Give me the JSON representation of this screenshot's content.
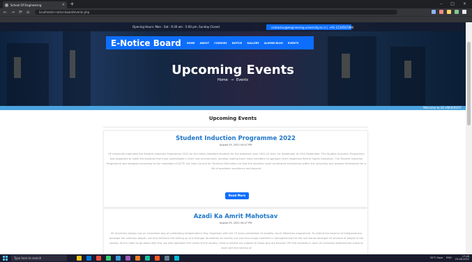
{
  "browser": {
    "tab_title": "School Of Engineering",
    "tab_close": "×",
    "new_tab": "+",
    "url": "localhost/e-notice-board/events.php",
    "bookmark": "M.Sc B.Tech",
    "window_controls": [
      "–",
      "□",
      "×"
    ],
    "nav_icons": [
      "←",
      "→",
      "⟳",
      "⌂"
    ],
    "ext_colors": [
      "#8ab4f8",
      "#f28b82",
      "#fdd663",
      "#81c995",
      "#e8eaed"
    ]
  },
  "topbar": {
    "hours": "Opening Hours: Mon - Sat : 9:30 am - 5:00 pm, Sunday Closed",
    "contact": "contactus@engineering.university.ac.in | +91-1234567890"
  },
  "navbar": {
    "brand": "E-Notice Board",
    "menu": [
      "HOME",
      "ABOUT",
      "COURSES",
      "NOTICE",
      "GALLERY",
      "ALUMNI BLOG",
      "EVENTS"
    ]
  },
  "hero": {
    "title": "Upcoming Events",
    "crumb_home": "Home",
    "crumb_arrow": "→",
    "crumb_current": "Events"
  },
  "welcome": "Welcome to SE UNIVERSITY",
  "section_heading": "Upcoming Events",
  "events": [
    {
      "title": "Student Induction Programme 2022",
      "date": "August 29, 2022 04:47 PM",
      "body": "SE University organised the Student Induction Programme 2022 for the newly admitted students for the academic year 2022-23 from 1st September to 15th September. The Student Induction Programme was organised to make the students feel more comfortable in their new environment, develop making them more confident to approach their respective field of higher education. The Student Induction Programme was designed according to the mandates of AICTE (All India Council for Technical Education) so that the students could acclimatise themselves within the university and prepare themselves for a life of academic excellence and beyond.",
      "button": "Read More"
    },
    {
      "title": "Azadi Ka Amrit Mahotsav",
      "date": "August 29, 2022 04:47 PM",
      "body": "SE University always has an innovative way of celebrating Independence Day. Especially with the 75 years celebration of Azaditsu Amrit Mahotsav programme. To extend the essence of Independence amongst the common people, not only enhance the setting up of a stronger foundation for society but also encourage members in strengthening the ties and bonds amongst all sections of people in the society. And in order to go about with this, we who represent the cream of the society, need to extend our support to those who are beyond 100 first students in each of university departments chose to work with the section of"
    }
  ],
  "taskbar": {
    "search_placeholder": "Type here to search",
    "weather": "30°C Haze",
    "time": "17:48",
    "date": "29-08-2022",
    "lang": "ENG",
    "app_colors": [
      "#f0c419",
      "#0078d4",
      "#e74c3c",
      "#2ecc71",
      "#3498db",
      "#9b59b6",
      "#e67e22",
      "#1abc9c",
      "#ff5722",
      "#607d8b",
      "#00bcd4"
    ]
  }
}
